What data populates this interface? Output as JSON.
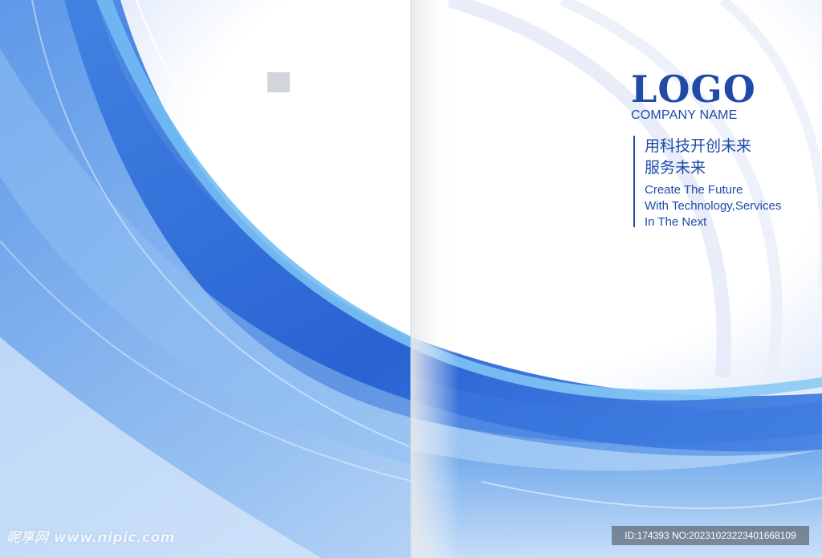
{
  "cover": {
    "logo": "LOGO",
    "company_name": "COMPANY NAME",
    "slogan_cn_line1": "用科技开创未来",
    "slogan_cn_line2": "服务未来",
    "slogan_en_line1": "Create The Future",
    "slogan_en_line2": "With Technology,Services",
    "slogan_en_line3": "In The Next"
  },
  "watermark": {
    "site": "昵享网 www.nipic.com",
    "id_text": "ID:174393 NO:20231023223401668109"
  },
  "colors": {
    "brand_blue": "#1f4aa8",
    "wave_deep": "#1e5fd6",
    "wave_mid": "#5aa6ee",
    "wave_light": "#bcd8f6"
  }
}
